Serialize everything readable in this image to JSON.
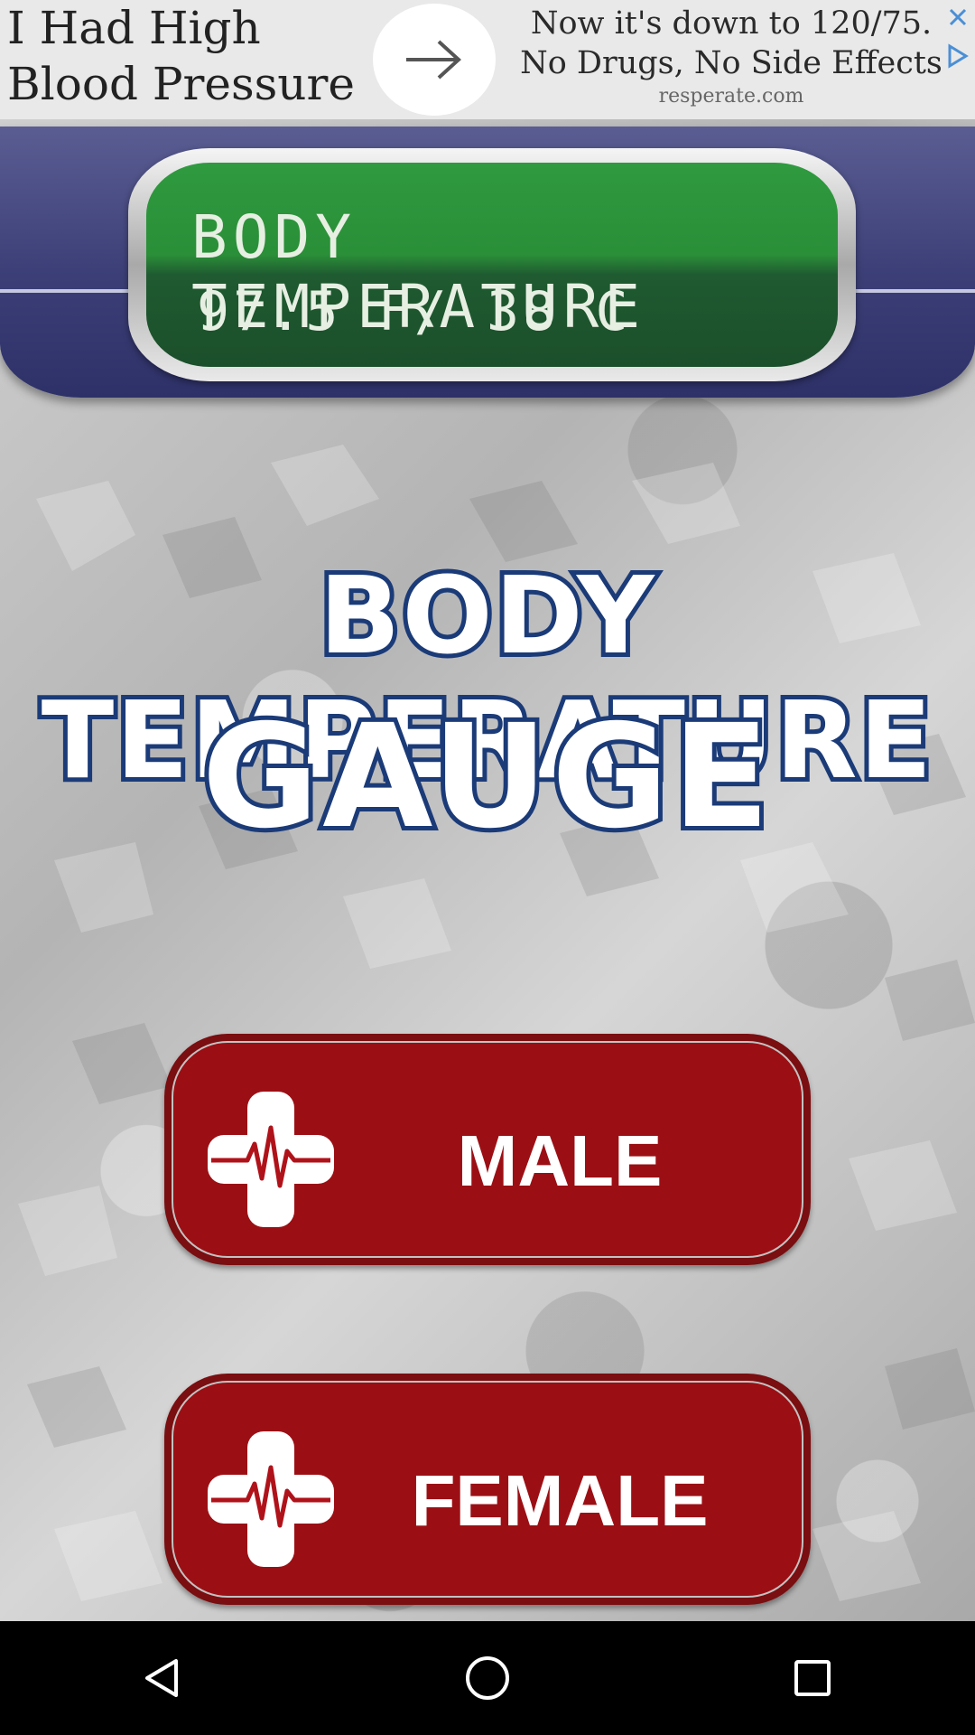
{
  "ad": {
    "left_text": "I Had High Blood Pressure",
    "right_text": "Now it's down to 120/75. No Drugs, No Side Effects",
    "domain": "resperate.com"
  },
  "display": {
    "line1": "BODY TEMPERATURE",
    "line2": "97.5 F/ 38 C"
  },
  "title": {
    "line1": "BODY TEMPERATURE",
    "line2": "GAUGE"
  },
  "buttons": {
    "male_label": "MALE",
    "female_label": "FEMALE"
  },
  "icons": {
    "ad_arrow": "arrow-right-icon",
    "ad_close": "close-icon",
    "ad_choices": "adchoices-icon",
    "cross": "medical-cross-heartbeat-icon",
    "nav_back": "back-triangle-icon",
    "nav_home": "home-circle-icon",
    "nav_recents": "recents-square-icon"
  },
  "colors": {
    "button_red": "#9b0f14",
    "lcd_green": "#2a8f38",
    "title_stroke": "#1b3b78",
    "header_blue": "#3c3f77"
  }
}
